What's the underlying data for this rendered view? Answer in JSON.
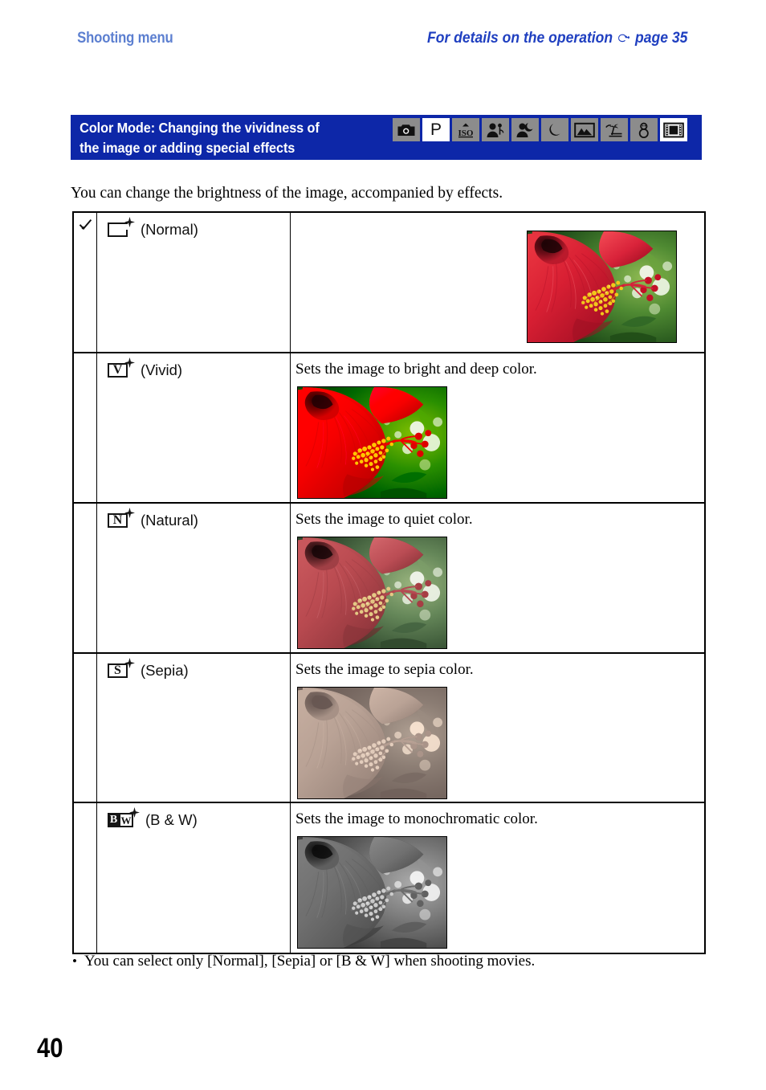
{
  "header": {
    "left_title": "Shooting menu",
    "right_title_before": "For details on the operation",
    "right_icon": "pointing-hand-icon",
    "right_title_after": "page 35"
  },
  "section": {
    "title_line1": "Color Mode: Changing the vividness of",
    "title_line2": "the image or adding special effects",
    "band_color": "#0d27a8",
    "mode_icons": [
      {
        "name": "auto-camera-mode-icon",
        "label": "Auto",
        "highlighted": false
      },
      {
        "name": "program-auto-mode-icon",
        "label": "P",
        "highlighted": true
      },
      {
        "name": "high-sensitivity-iso-mode-icon",
        "label": "ISO",
        "highlighted": false
      },
      {
        "name": "soft-snap-mode-icon",
        "label": "Soft Snap",
        "highlighted": false
      },
      {
        "name": "twilight-portrait-mode-icon",
        "label": "Twilight Portrait",
        "highlighted": false
      },
      {
        "name": "twilight-mode-icon",
        "label": "Twilight",
        "highlighted": false
      },
      {
        "name": "landscape-mode-icon",
        "label": "Landscape",
        "highlighted": false
      },
      {
        "name": "beach-mode-icon",
        "label": "Beach",
        "highlighted": false
      },
      {
        "name": "snow-mode-icon",
        "label": "Snow",
        "highlighted": false
      },
      {
        "name": "movie-mode-icon",
        "label": "Movie",
        "highlighted": true
      }
    ]
  },
  "intro": "You can change the brightness of the image, accompanied by effects.",
  "table": {
    "rows": [
      {
        "checked": true,
        "check_glyph": "✓",
        "icon_char": "",
        "icon_kind": "open-box",
        "label": "(Normal)",
        "description": "",
        "photo_style": "normal"
      },
      {
        "checked": false,
        "check_glyph": "",
        "icon_char": "V",
        "icon_kind": "box",
        "label": "(Vivid)",
        "description": "Sets the image to bright and deep color.",
        "photo_style": "vivid"
      },
      {
        "checked": false,
        "check_glyph": "",
        "icon_char": "N",
        "icon_kind": "box",
        "label": "(Natural)",
        "description": "Sets the image to quiet color.",
        "photo_style": "natural"
      },
      {
        "checked": false,
        "check_glyph": "",
        "icon_char": "S",
        "icon_kind": "box",
        "label": "(Sepia)",
        "description": "Sets the image to sepia color.",
        "photo_style": "sepia"
      },
      {
        "checked": false,
        "check_glyph": "",
        "icon_char": "BW",
        "icon_kind": "bw-box",
        "label": "(B & W)",
        "description": "Sets the image to monochromatic color.",
        "photo_style": "bw"
      }
    ]
  },
  "footnote": {
    "bullet": "•",
    "text": "You can select only [Normal], [Sepia] or [B & W] when shooting movies."
  },
  "page_number": "40",
  "photo_subject": "red hibiscus flower close-up with yellow stamens and green foliage"
}
